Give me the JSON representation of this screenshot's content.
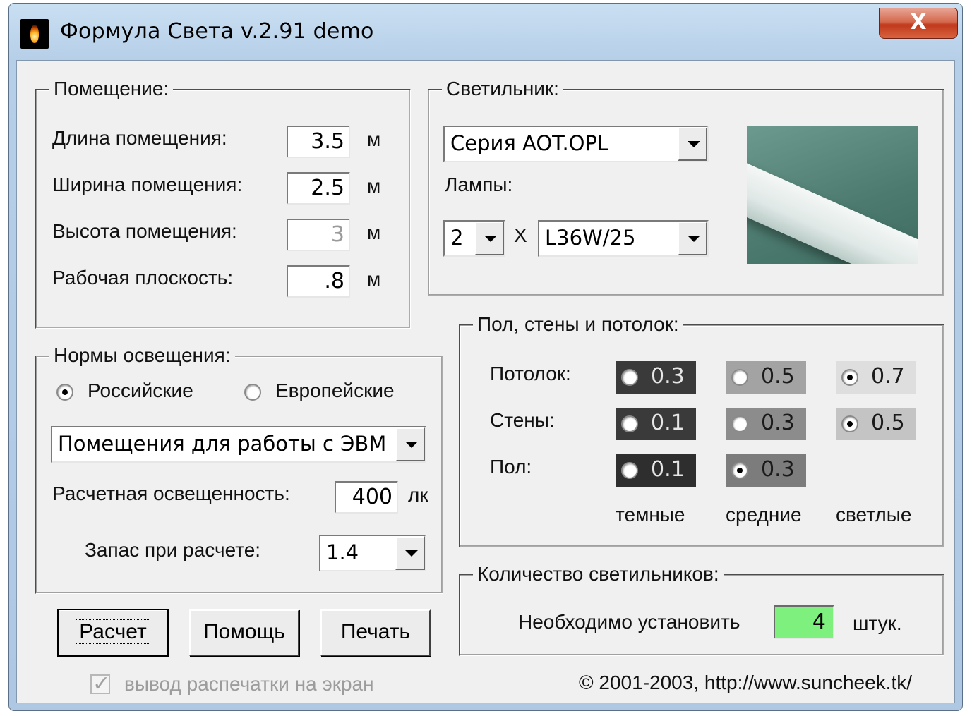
{
  "window": {
    "title": "Формула Света v.2.91 demo",
    "close_glyph": "X"
  },
  "room": {
    "legend": "Помещение:",
    "length_label": "Длина помещения:",
    "length_value": "3.5",
    "width_label": "Ширина помещения:",
    "width_value": "2.5",
    "height_label": "Высота помещения:",
    "height_value": "3",
    "workplane_label": "Рабочая плоскость:",
    "workplane_value": ".8",
    "unit": "м"
  },
  "luminaire": {
    "legend": "Светильник:",
    "series": "Серия AOT.OPL",
    "lamps_label": "Лампы:",
    "lamp_count": "2",
    "times": "X",
    "lamp_type": "L36W/25"
  },
  "norms": {
    "legend": "Нормы освещения:",
    "russian": "Российские",
    "european": "Европейские",
    "selected": "russian",
    "room_type": "Помещения для работы с ЭВМ",
    "illuminance_label": "Расчетная освещенность:",
    "illuminance_value": "400",
    "illuminance_unit": "лк",
    "reserve_label": "Запас при расчете:",
    "reserve_value": "1.4"
  },
  "reflectance": {
    "legend": "Пол, стены и потолок:",
    "ceiling_label": "Потолок:",
    "walls_label": "Стены:",
    "floor_label": "Пол:",
    "ceiling": [
      "0.3",
      "0.5",
      "0.7"
    ],
    "walls": [
      "0.1",
      "0.3",
      "0.5"
    ],
    "floor": [
      "0.1",
      "0.3"
    ],
    "selected": {
      "ceiling": "0.7",
      "walls": "0.5",
      "floor": "0.3"
    },
    "col_dark": "темные",
    "col_mid": "средние",
    "col_light": "светлые",
    "colors": {
      "dark": "#3a3a3a",
      "mid": "#a3a3a3",
      "light": "#dedede"
    }
  },
  "count": {
    "legend": "Количество светильников:",
    "need_label": "Необходимо установить",
    "value": "4",
    "unit": "штук.",
    "value_bg": "#7ef07e"
  },
  "buttons": {
    "calc": "Расчет",
    "help": "Помощь",
    "print": "Печать"
  },
  "footer": {
    "print_preview": "вывод распечатки на экран",
    "copyright": "© 2001-2003, http://www.suncheek.tk/"
  }
}
